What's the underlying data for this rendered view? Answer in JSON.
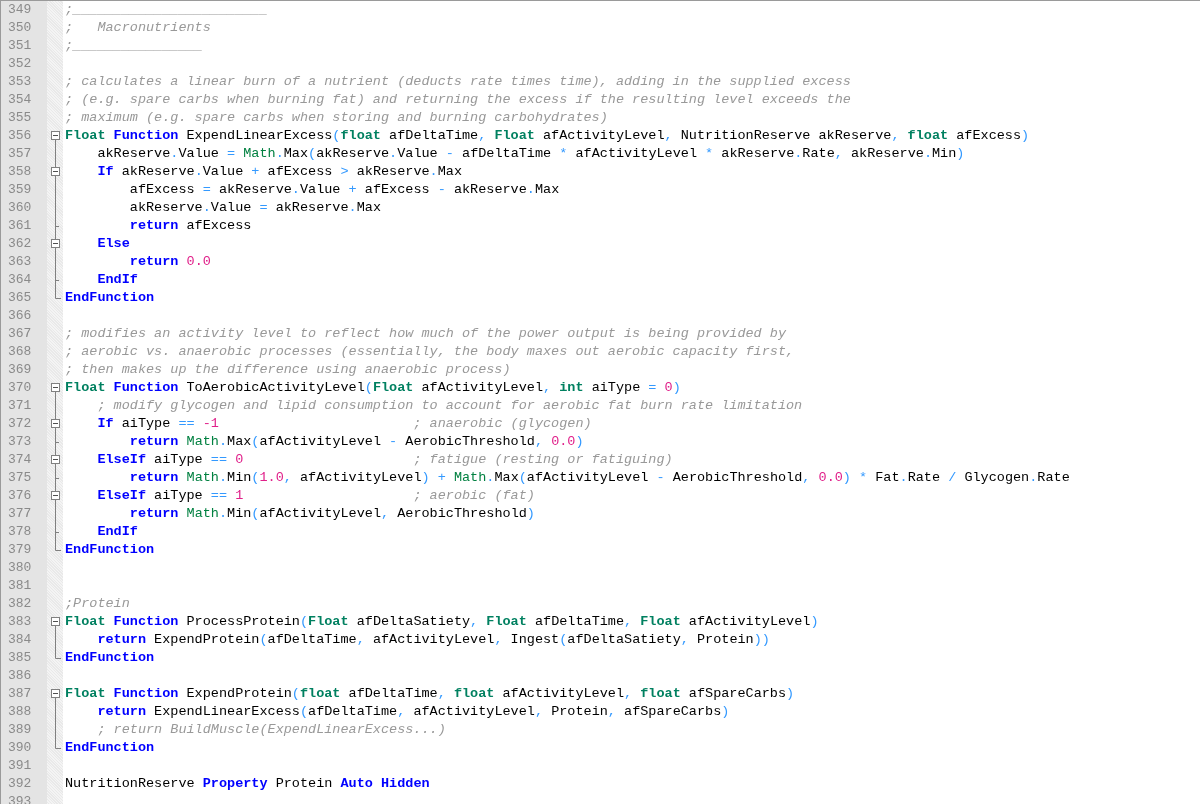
{
  "editor": {
    "lines": [
      {
        "number": "349",
        "tokens": [
          {
            "kind": "comment",
            "text": ";________________________"
          }
        ]
      },
      {
        "number": "350",
        "tokens": [
          {
            "kind": "comment",
            "text": ";   Macronutrients"
          }
        ]
      },
      {
        "number": "351",
        "tokens": [
          {
            "kind": "comment",
            "text": ";________________"
          }
        ]
      },
      {
        "number": "352"
      },
      {
        "number": "353",
        "tokens": [
          {
            "kind": "comment",
            "text": "; calculates a linear burn of a nutrient (deducts rate times time), adding in the supplied excess"
          }
        ]
      },
      {
        "number": "354",
        "tokens": [
          {
            "kind": "comment",
            "text": "; (e.g. spare carbs when burning fat) and returning the excess if the resulting level exceeds the"
          }
        ]
      },
      {
        "number": "355",
        "tokens": [
          {
            "kind": "comment",
            "text": "; maximum (e.g. spare carbs when storing and burning carbohydrates)"
          }
        ]
      },
      {
        "number": "356",
        "fold": {
          "kind": "start"
        },
        "tokens": [
          {
            "kind": "type",
            "text": "Float "
          },
          {
            "kind": "keyword",
            "text": "Function"
          },
          {
            "kind": "plain",
            "text": " ExpendLinearExcess"
          },
          {
            "kind": "operator",
            "text": "("
          },
          {
            "kind": "type",
            "text": "float"
          },
          {
            "kind": "plain",
            "text": " afDeltaTime"
          },
          {
            "kind": "operator",
            "text": ", "
          },
          {
            "kind": "type",
            "text": "Float"
          },
          {
            "kind": "plain",
            "text": " afActivityLevel"
          },
          {
            "kind": "operator",
            "text": ","
          },
          {
            "kind": "plain",
            "text": " NutritionReserve akReserve"
          },
          {
            "kind": "operator",
            "text": ", "
          },
          {
            "kind": "type",
            "text": "float"
          },
          {
            "kind": "plain",
            "text": " afExcess"
          },
          {
            "kind": "operator",
            "text": ")"
          }
        ]
      },
      {
        "number": "357",
        "fold": {
          "kind": "body"
        },
        "tokens": [
          {
            "kind": "plain",
            "text": "    akReserve"
          },
          {
            "kind": "operator",
            "text": "."
          },
          {
            "kind": "plain",
            "text": "Value "
          },
          {
            "kind": "operator",
            "text": "= "
          },
          {
            "kind": "builtin",
            "text": "Math"
          },
          {
            "kind": "operator",
            "text": "."
          },
          {
            "kind": "plain",
            "text": "Max"
          },
          {
            "kind": "operator",
            "text": "("
          },
          {
            "kind": "plain",
            "text": "akReserve"
          },
          {
            "kind": "operator",
            "text": "."
          },
          {
            "kind": "plain",
            "text": "Value "
          },
          {
            "kind": "operator",
            "text": "-"
          },
          {
            "kind": "plain",
            "text": " afDeltaTime "
          },
          {
            "kind": "operator",
            "text": "*"
          },
          {
            "kind": "plain",
            "text": " afActivityLevel "
          },
          {
            "kind": "operator",
            "text": "*"
          },
          {
            "kind": "plain",
            "text": " akReserve"
          },
          {
            "kind": "operator",
            "text": "."
          },
          {
            "kind": "plain",
            "text": "Rate"
          },
          {
            "kind": "operator",
            "text": ","
          },
          {
            "kind": "plain",
            "text": " akReserve"
          },
          {
            "kind": "operator",
            "text": "."
          },
          {
            "kind": "plain",
            "text": "Min"
          },
          {
            "kind": "operator",
            "text": ")"
          }
        ]
      },
      {
        "number": "358",
        "fold": {
          "kind": "start"
        },
        "tokens": [
          {
            "kind": "keyword",
            "text": "    If"
          },
          {
            "kind": "plain",
            "text": " akReserve"
          },
          {
            "kind": "operator",
            "text": "."
          },
          {
            "kind": "plain",
            "text": "Value "
          },
          {
            "kind": "operator",
            "text": "+"
          },
          {
            "kind": "plain",
            "text": " afExcess "
          },
          {
            "kind": "operator",
            "text": ">"
          },
          {
            "kind": "plain",
            "text": " akReserve"
          },
          {
            "kind": "operator",
            "text": "."
          },
          {
            "kind": "plain",
            "text": "Max"
          }
        ]
      },
      {
        "number": "359",
        "fold": {
          "kind": "body"
        },
        "tokens": [
          {
            "kind": "plain",
            "text": "        afExcess "
          },
          {
            "kind": "operator",
            "text": "="
          },
          {
            "kind": "plain",
            "text": " akReserve"
          },
          {
            "kind": "operator",
            "text": "."
          },
          {
            "kind": "plain",
            "text": "Value "
          },
          {
            "kind": "operator",
            "text": "+"
          },
          {
            "kind": "plain",
            "text": " afExcess "
          },
          {
            "kind": "operator",
            "text": "-"
          },
          {
            "kind": "plain",
            "text": " akReserve"
          },
          {
            "kind": "operator",
            "text": "."
          },
          {
            "kind": "plain",
            "text": "Max"
          }
        ]
      },
      {
        "number": "360",
        "fold": {
          "kind": "body"
        },
        "tokens": [
          {
            "kind": "plain",
            "text": "        akReserve"
          },
          {
            "kind": "operator",
            "text": "."
          },
          {
            "kind": "plain",
            "text": "Value "
          },
          {
            "kind": "operator",
            "text": "="
          },
          {
            "kind": "plain",
            "text": " akReserve"
          },
          {
            "kind": "operator",
            "text": "."
          },
          {
            "kind": "plain",
            "text": "Max"
          }
        ]
      },
      {
        "number": "361",
        "fold": {
          "kind": "tick"
        },
        "tokens": [
          {
            "kind": "keyword",
            "text": "        return"
          },
          {
            "kind": "plain",
            "text": " afExcess"
          }
        ]
      },
      {
        "number": "362",
        "fold": {
          "kind": "start"
        },
        "tokens": [
          {
            "kind": "keyword",
            "text": "    Else"
          }
        ]
      },
      {
        "number": "363",
        "fold": {
          "kind": "body"
        },
        "tokens": [
          {
            "kind": "keyword",
            "text": "        return "
          },
          {
            "kind": "number",
            "text": "0.0"
          }
        ]
      },
      {
        "number": "364",
        "fold": {
          "kind": "tick"
        },
        "tokens": [
          {
            "kind": "keyword",
            "text": "    EndIf"
          }
        ]
      },
      {
        "number": "365",
        "fold": {
          "kind": "end"
        },
        "tokens": [
          {
            "kind": "keyword",
            "text": "EndFunction"
          }
        ]
      },
      {
        "number": "366"
      },
      {
        "number": "367",
        "tokens": [
          {
            "kind": "comment",
            "text": "; modifies an activity level to reflect how much of the power output is being provided by"
          }
        ]
      },
      {
        "number": "368",
        "tokens": [
          {
            "kind": "comment",
            "text": "; aerobic vs. anaerobic processes (essentially, the body maxes out aerobic capacity first,"
          }
        ]
      },
      {
        "number": "369",
        "tokens": [
          {
            "kind": "comment",
            "text": "; then makes up the difference using anaerobic process)"
          }
        ]
      },
      {
        "number": "370",
        "fold": {
          "kind": "start"
        },
        "tokens": [
          {
            "kind": "type",
            "text": "Float "
          },
          {
            "kind": "keyword",
            "text": "Function"
          },
          {
            "kind": "plain",
            "text": " ToAerobicActivityLevel"
          },
          {
            "kind": "operator",
            "text": "("
          },
          {
            "kind": "type",
            "text": "Float"
          },
          {
            "kind": "plain",
            "text": " afActivityLevel"
          },
          {
            "kind": "operator",
            "text": ", "
          },
          {
            "kind": "type",
            "text": "int"
          },
          {
            "kind": "plain",
            "text": " aiType "
          },
          {
            "kind": "operator",
            "text": "= "
          },
          {
            "kind": "number",
            "text": "0"
          },
          {
            "kind": "operator",
            "text": ")"
          }
        ]
      },
      {
        "number": "371",
        "fold": {
          "kind": "body"
        },
        "tokens": [
          {
            "kind": "comment",
            "text": "    ; modify glycogen and lipid consumption to account for aerobic fat burn rate limitation"
          }
        ]
      },
      {
        "number": "372",
        "fold": {
          "kind": "start"
        },
        "tokens": [
          {
            "kind": "keyword",
            "text": "    If"
          },
          {
            "kind": "plain",
            "text": " aiType "
          },
          {
            "kind": "operator",
            "text": "== "
          },
          {
            "kind": "number",
            "text": "-1"
          },
          {
            "kind": "comment",
            "text": "                        ; anaerobic (glycogen)"
          }
        ]
      },
      {
        "number": "373",
        "fold": {
          "kind": "tick"
        },
        "tokens": [
          {
            "kind": "keyword",
            "text": "        return "
          },
          {
            "kind": "builtin",
            "text": "Math"
          },
          {
            "kind": "operator",
            "text": "."
          },
          {
            "kind": "plain",
            "text": "Max"
          },
          {
            "kind": "operator",
            "text": "("
          },
          {
            "kind": "plain",
            "text": "afActivityLevel "
          },
          {
            "kind": "operator",
            "text": "-"
          },
          {
            "kind": "plain",
            "text": " AerobicThreshold"
          },
          {
            "kind": "operator",
            "text": ", "
          },
          {
            "kind": "number",
            "text": "0.0"
          },
          {
            "kind": "operator",
            "text": ")"
          }
        ]
      },
      {
        "number": "374",
        "fold": {
          "kind": "start"
        },
        "tokens": [
          {
            "kind": "keyword",
            "text": "    ElseIf"
          },
          {
            "kind": "plain",
            "text": " aiType "
          },
          {
            "kind": "operator",
            "text": "== "
          },
          {
            "kind": "number",
            "text": "0"
          },
          {
            "kind": "comment",
            "text": "                     ; fatigue (resting or fatiguing)"
          }
        ]
      },
      {
        "number": "375",
        "fold": {
          "kind": "tick"
        },
        "tokens": [
          {
            "kind": "keyword",
            "text": "        return "
          },
          {
            "kind": "builtin",
            "text": "Math"
          },
          {
            "kind": "operator",
            "text": "."
          },
          {
            "kind": "plain",
            "text": "Min"
          },
          {
            "kind": "operator",
            "text": "("
          },
          {
            "kind": "number",
            "text": "1.0"
          },
          {
            "kind": "operator",
            "text": ","
          },
          {
            "kind": "plain",
            "text": " afActivityLevel"
          },
          {
            "kind": "operator",
            "text": ") + "
          },
          {
            "kind": "builtin",
            "text": "Math"
          },
          {
            "kind": "operator",
            "text": "."
          },
          {
            "kind": "plain",
            "text": "Max"
          },
          {
            "kind": "operator",
            "text": "("
          },
          {
            "kind": "plain",
            "text": "afActivityLevel "
          },
          {
            "kind": "operator",
            "text": "-"
          },
          {
            "kind": "plain",
            "text": " AerobicThreshold"
          },
          {
            "kind": "operator",
            "text": ", "
          },
          {
            "kind": "number",
            "text": "0.0"
          },
          {
            "kind": "operator",
            "text": ") *"
          },
          {
            "kind": "plain",
            "text": " Fat"
          },
          {
            "kind": "operator",
            "text": "."
          },
          {
            "kind": "plain",
            "text": "Rate "
          },
          {
            "kind": "operator",
            "text": "/"
          },
          {
            "kind": "plain",
            "text": " Glycogen"
          },
          {
            "kind": "operator",
            "text": "."
          },
          {
            "kind": "plain",
            "text": "Rate"
          }
        ]
      },
      {
        "number": "376",
        "fold": {
          "kind": "start"
        },
        "tokens": [
          {
            "kind": "keyword",
            "text": "    ElseIf"
          },
          {
            "kind": "plain",
            "text": " aiType "
          },
          {
            "kind": "operator",
            "text": "== "
          },
          {
            "kind": "number",
            "text": "1"
          },
          {
            "kind": "comment",
            "text": "                     ; aerobic (fat)"
          }
        ]
      },
      {
        "number": "377",
        "fold": {
          "kind": "body"
        },
        "tokens": [
          {
            "kind": "keyword",
            "text": "        return "
          },
          {
            "kind": "builtin",
            "text": "Math"
          },
          {
            "kind": "operator",
            "text": "."
          },
          {
            "kind": "plain",
            "text": "Min"
          },
          {
            "kind": "operator",
            "text": "("
          },
          {
            "kind": "plain",
            "text": "afActivityLevel"
          },
          {
            "kind": "operator",
            "text": ","
          },
          {
            "kind": "plain",
            "text": " AerobicThreshold"
          },
          {
            "kind": "operator",
            "text": ")"
          }
        ]
      },
      {
        "number": "378",
        "fold": {
          "kind": "tick"
        },
        "tokens": [
          {
            "kind": "keyword",
            "text": "    EndIf"
          }
        ]
      },
      {
        "number": "379",
        "fold": {
          "kind": "end"
        },
        "tokens": [
          {
            "kind": "keyword",
            "text": "EndFunction"
          }
        ]
      },
      {
        "number": "380"
      },
      {
        "number": "381"
      },
      {
        "number": "382",
        "tokens": [
          {
            "kind": "comment",
            "text": ";Protein"
          }
        ]
      },
      {
        "number": "383",
        "fold": {
          "kind": "start"
        },
        "tokens": [
          {
            "kind": "type",
            "text": "Float "
          },
          {
            "kind": "keyword",
            "text": "Function"
          },
          {
            "kind": "plain",
            "text": " ProcessProtein"
          },
          {
            "kind": "operator",
            "text": "("
          },
          {
            "kind": "type",
            "text": "Float"
          },
          {
            "kind": "plain",
            "text": " afDeltaSatiety"
          },
          {
            "kind": "operator",
            "text": ", "
          },
          {
            "kind": "type",
            "text": "Float"
          },
          {
            "kind": "plain",
            "text": " afDeltaTime"
          },
          {
            "kind": "operator",
            "text": ", "
          },
          {
            "kind": "type",
            "text": "Float"
          },
          {
            "kind": "plain",
            "text": " afActivityLevel"
          },
          {
            "kind": "operator",
            "text": ")"
          }
        ]
      },
      {
        "number": "384",
        "fold": {
          "kind": "body"
        },
        "tokens": [
          {
            "kind": "keyword",
            "text": "    return"
          },
          {
            "kind": "plain",
            "text": " ExpendProtein"
          },
          {
            "kind": "operator",
            "text": "("
          },
          {
            "kind": "plain",
            "text": "afDeltaTime"
          },
          {
            "kind": "operator",
            "text": ","
          },
          {
            "kind": "plain",
            "text": " afActivityLevel"
          },
          {
            "kind": "operator",
            "text": ","
          },
          {
            "kind": "plain",
            "text": " Ingest"
          },
          {
            "kind": "operator",
            "text": "("
          },
          {
            "kind": "plain",
            "text": "afDeltaSatiety"
          },
          {
            "kind": "operator",
            "text": ","
          },
          {
            "kind": "plain",
            "text": " Protein"
          },
          {
            "kind": "operator",
            "text": "))"
          }
        ]
      },
      {
        "number": "385",
        "fold": {
          "kind": "end"
        },
        "tokens": [
          {
            "kind": "keyword",
            "text": "EndFunction"
          }
        ]
      },
      {
        "number": "386"
      },
      {
        "number": "387",
        "fold": {
          "kind": "start"
        },
        "tokens": [
          {
            "kind": "type",
            "text": "Float "
          },
          {
            "kind": "keyword",
            "text": "Function"
          },
          {
            "kind": "plain",
            "text": " ExpendProtein"
          },
          {
            "kind": "operator",
            "text": "("
          },
          {
            "kind": "type",
            "text": "float"
          },
          {
            "kind": "plain",
            "text": " afDeltaTime"
          },
          {
            "kind": "operator",
            "text": ", "
          },
          {
            "kind": "type",
            "text": "float"
          },
          {
            "kind": "plain",
            "text": " afActivityLevel"
          },
          {
            "kind": "operator",
            "text": ", "
          },
          {
            "kind": "type",
            "text": "float"
          },
          {
            "kind": "plain",
            "text": " afSpareCarbs"
          },
          {
            "kind": "operator",
            "text": ")"
          }
        ]
      },
      {
        "number": "388",
        "fold": {
          "kind": "body"
        },
        "tokens": [
          {
            "kind": "keyword",
            "text": "    return"
          },
          {
            "kind": "plain",
            "text": " ExpendLinearExcess"
          },
          {
            "kind": "operator",
            "text": "("
          },
          {
            "kind": "plain",
            "text": "afDeltaTime"
          },
          {
            "kind": "operator",
            "text": ","
          },
          {
            "kind": "plain",
            "text": " afActivityLevel"
          },
          {
            "kind": "operator",
            "text": ","
          },
          {
            "kind": "plain",
            "text": " Protein"
          },
          {
            "kind": "operator",
            "text": ","
          },
          {
            "kind": "plain",
            "text": " afSpareCarbs"
          },
          {
            "kind": "operator",
            "text": ")"
          }
        ]
      },
      {
        "number": "389",
        "fold": {
          "kind": "body"
        },
        "tokens": [
          {
            "kind": "comment",
            "text": "    ; return BuildMuscle(ExpendLinearExcess...)"
          }
        ]
      },
      {
        "number": "390",
        "fold": {
          "kind": "end"
        },
        "tokens": [
          {
            "kind": "keyword",
            "text": "EndFunction"
          }
        ]
      },
      {
        "number": "391"
      },
      {
        "number": "392",
        "tokens": [
          {
            "kind": "plain",
            "text": "NutritionReserve "
          },
          {
            "kind": "keyword",
            "text": "Property"
          },
          {
            "kind": "plain",
            "text": " Protein "
          },
          {
            "kind": "keyword",
            "text": "Auto Hidden"
          }
        ]
      },
      {
        "number": "393"
      }
    ]
  }
}
